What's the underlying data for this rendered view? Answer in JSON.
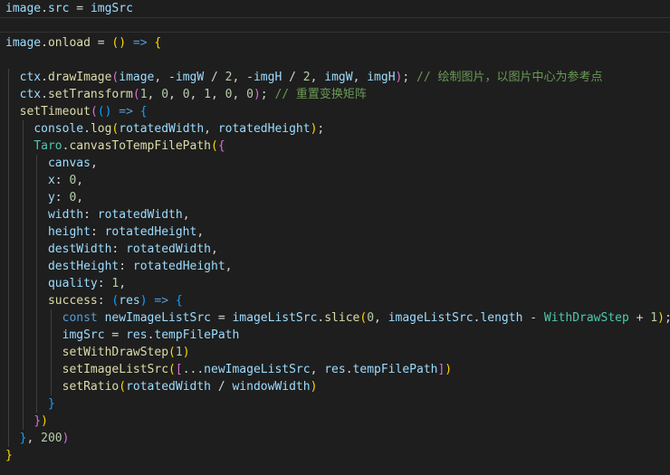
{
  "editor": {
    "background": "#1e1e1e",
    "lines": [
      [
        [
          "image",
          "var"
        ],
        [
          ".",
          "plain"
        ],
        [
          "src",
          "var"
        ],
        [
          " = ",
          "plain"
        ],
        [
          "imgSrc",
          "var"
        ]
      ],
      [],
      [
        [
          "image",
          "var"
        ],
        [
          ".",
          "plain"
        ],
        [
          "onload",
          "fn"
        ],
        [
          " = ",
          "plain"
        ],
        [
          "(",
          "b1"
        ],
        [
          ")",
          "b1"
        ],
        [
          " ",
          "plain"
        ],
        [
          "=>",
          "kw"
        ],
        [
          " ",
          "plain"
        ],
        [
          "{",
          "b1"
        ]
      ],
      [],
      [
        [
          "  ",
          "plain"
        ],
        [
          "ctx",
          "var"
        ],
        [
          ".",
          "plain"
        ],
        [
          "drawImage",
          "fn"
        ],
        [
          "(",
          "b2"
        ],
        [
          "image",
          "var"
        ],
        [
          ", -",
          "plain"
        ],
        [
          "imgW",
          "var"
        ],
        [
          " / ",
          "plain"
        ],
        [
          "2",
          "num"
        ],
        [
          ", -",
          "plain"
        ],
        [
          "imgH",
          "var"
        ],
        [
          " / ",
          "plain"
        ],
        [
          "2",
          "num"
        ],
        [
          ", ",
          "plain"
        ],
        [
          "imgW",
          "var"
        ],
        [
          ", ",
          "plain"
        ],
        [
          "imgH",
          "var"
        ],
        [
          ")",
          "b2"
        ],
        [
          "; ",
          "plain"
        ],
        [
          "// 绘制图片，以图片中心为参考点",
          "com"
        ]
      ],
      [
        [
          "  ",
          "plain"
        ],
        [
          "ctx",
          "var"
        ],
        [
          ".",
          "plain"
        ],
        [
          "setTransform",
          "fn"
        ],
        [
          "(",
          "b2"
        ],
        [
          "1",
          "num"
        ],
        [
          ", ",
          "plain"
        ],
        [
          "0",
          "num"
        ],
        [
          ", ",
          "plain"
        ],
        [
          "0",
          "num"
        ],
        [
          ", ",
          "plain"
        ],
        [
          "1",
          "num"
        ],
        [
          ", ",
          "plain"
        ],
        [
          "0",
          "num"
        ],
        [
          ", ",
          "plain"
        ],
        [
          "0",
          "num"
        ],
        [
          ")",
          "b2"
        ],
        [
          "; ",
          "plain"
        ],
        [
          "// 重置变换矩阵",
          "com"
        ]
      ],
      [
        [
          "  ",
          "plain"
        ],
        [
          "setTimeout",
          "fn"
        ],
        [
          "(",
          "b2"
        ],
        [
          "(",
          "b3"
        ],
        [
          ")",
          "b3"
        ],
        [
          " ",
          "plain"
        ],
        [
          "=>",
          "kw"
        ],
        [
          " ",
          "plain"
        ],
        [
          "{",
          "b3"
        ]
      ],
      [
        [
          "    ",
          "plain"
        ],
        [
          "console",
          "var"
        ],
        [
          ".",
          "plain"
        ],
        [
          "log",
          "fn"
        ],
        [
          "(",
          "b1"
        ],
        [
          "rotatedWidth",
          "var"
        ],
        [
          ", ",
          "plain"
        ],
        [
          "rotatedHeight",
          "var"
        ],
        [
          ")",
          "b1"
        ],
        [
          ";",
          "plain"
        ]
      ],
      [
        [
          "    ",
          "plain"
        ],
        [
          "Taro",
          "cls"
        ],
        [
          ".",
          "plain"
        ],
        [
          "canvasToTempFilePath",
          "fn"
        ],
        [
          "(",
          "b1"
        ],
        [
          "{",
          "b2"
        ]
      ],
      [
        [
          "      ",
          "plain"
        ],
        [
          "canvas",
          "var"
        ],
        [
          ",",
          "plain"
        ]
      ],
      [
        [
          "      ",
          "plain"
        ],
        [
          "x",
          "var"
        ],
        [
          ": ",
          "plain"
        ],
        [
          "0",
          "num"
        ],
        [
          ",",
          "plain"
        ]
      ],
      [
        [
          "      ",
          "plain"
        ],
        [
          "y",
          "var"
        ],
        [
          ": ",
          "plain"
        ],
        [
          "0",
          "num"
        ],
        [
          ",",
          "plain"
        ]
      ],
      [
        [
          "      ",
          "plain"
        ],
        [
          "width",
          "var"
        ],
        [
          ": ",
          "plain"
        ],
        [
          "rotatedWidth",
          "var"
        ],
        [
          ",",
          "plain"
        ]
      ],
      [
        [
          "      ",
          "plain"
        ],
        [
          "height",
          "var"
        ],
        [
          ": ",
          "plain"
        ],
        [
          "rotatedHeight",
          "var"
        ],
        [
          ",",
          "plain"
        ]
      ],
      [
        [
          "      ",
          "plain"
        ],
        [
          "destWidth",
          "var"
        ],
        [
          ": ",
          "plain"
        ],
        [
          "rotatedWidth",
          "var"
        ],
        [
          ",",
          "plain"
        ]
      ],
      [
        [
          "      ",
          "plain"
        ],
        [
          "destHeight",
          "var"
        ],
        [
          ": ",
          "plain"
        ],
        [
          "rotatedHeight",
          "var"
        ],
        [
          ",",
          "plain"
        ]
      ],
      [
        [
          "      ",
          "plain"
        ],
        [
          "quality",
          "var"
        ],
        [
          ": ",
          "plain"
        ],
        [
          "1",
          "num"
        ],
        [
          ",",
          "plain"
        ]
      ],
      [
        [
          "      ",
          "plain"
        ],
        [
          "success",
          "fn"
        ],
        [
          ": ",
          "plain"
        ],
        [
          "(",
          "b3"
        ],
        [
          "res",
          "var"
        ],
        [
          ")",
          "b3"
        ],
        [
          " ",
          "plain"
        ],
        [
          "=>",
          "kw"
        ],
        [
          " ",
          "plain"
        ],
        [
          "{",
          "b3"
        ]
      ],
      [
        [
          "        ",
          "plain"
        ],
        [
          "const",
          "kw"
        ],
        [
          " ",
          "plain"
        ],
        [
          "newImageListSrc",
          "var"
        ],
        [
          " = ",
          "plain"
        ],
        [
          "imageListSrc",
          "var"
        ],
        [
          ".",
          "plain"
        ],
        [
          "slice",
          "fn"
        ],
        [
          "(",
          "b1"
        ],
        [
          "0",
          "num"
        ],
        [
          ", ",
          "plain"
        ],
        [
          "imageListSrc",
          "var"
        ],
        [
          ".",
          "plain"
        ],
        [
          "length",
          "var"
        ],
        [
          " - ",
          "plain"
        ],
        [
          "WithDrawStep",
          "cls"
        ],
        [
          " + ",
          "plain"
        ],
        [
          "1",
          "num"
        ],
        [
          ")",
          "b1"
        ],
        [
          ";",
          "plain"
        ]
      ],
      [
        [
          "        ",
          "plain"
        ],
        [
          "imgSrc",
          "var"
        ],
        [
          " = ",
          "plain"
        ],
        [
          "res",
          "var"
        ],
        [
          ".",
          "plain"
        ],
        [
          "tempFilePath",
          "var"
        ]
      ],
      [
        [
          "        ",
          "plain"
        ],
        [
          "setWithDrawStep",
          "fn"
        ],
        [
          "(",
          "b1"
        ],
        [
          "1",
          "num"
        ],
        [
          ")",
          "b1"
        ]
      ],
      [
        [
          "        ",
          "plain"
        ],
        [
          "setImageListSrc",
          "fn"
        ],
        [
          "(",
          "b1"
        ],
        [
          "[",
          "b2"
        ],
        [
          "...",
          "plain"
        ],
        [
          "newImageListSrc",
          "var"
        ],
        [
          ", ",
          "plain"
        ],
        [
          "res",
          "var"
        ],
        [
          ".",
          "plain"
        ],
        [
          "tempFilePath",
          "var"
        ],
        [
          "]",
          "b2"
        ],
        [
          ")",
          "b1"
        ]
      ],
      [
        [
          "        ",
          "plain"
        ],
        [
          "setRatio",
          "fn"
        ],
        [
          "(",
          "b1"
        ],
        [
          "rotatedWidth",
          "var"
        ],
        [
          " / ",
          "plain"
        ],
        [
          "windowWidth",
          "var"
        ],
        [
          ")",
          "b1"
        ]
      ],
      [
        [
          "      ",
          "plain"
        ],
        [
          "}",
          "b3"
        ]
      ],
      [
        [
          "    ",
          "plain"
        ],
        [
          "}",
          "b2"
        ],
        [
          ")",
          "b1"
        ]
      ],
      [
        [
          "  ",
          "plain"
        ],
        [
          "}",
          "b3"
        ],
        [
          ", ",
          "plain"
        ],
        [
          "200",
          "num"
        ],
        [
          ")",
          "b2"
        ]
      ],
      [
        [
          "}",
          "b1"
        ]
      ]
    ]
  }
}
